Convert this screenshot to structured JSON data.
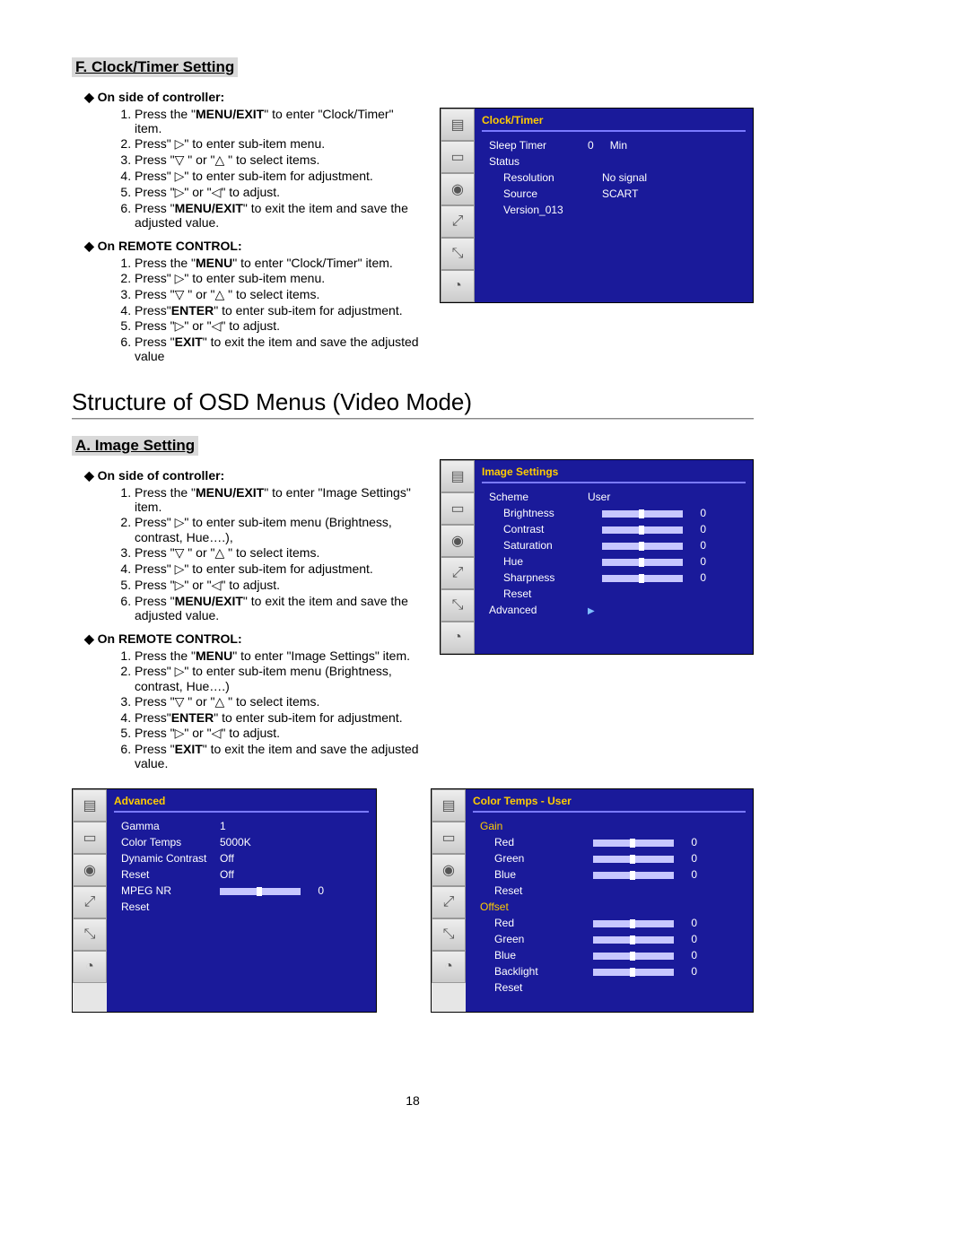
{
  "sectionF": {
    "title": "F. Clock/Timer Setting",
    "side_head": "On side of controller:",
    "side_steps": [
      "Press the \"<b class='k'>MENU/EXIT</b>\" to enter \"Clock/Timer\" item.",
      "Press\" ▷\" to enter sub-item menu.",
      "Press \"▽ \" or \"△ \" to select items.",
      "Press\" ▷\" to enter sub-item for adjustment.",
      "Press \"▷\" or \"◁\" to adjust.",
      "Press \"<b class='k'>MENU/EXIT</b>\" to exit the item and save the adjusted value."
    ],
    "remote_head": "On REMOTE CONTROL:",
    "remote_steps": [
      "Press the \"<b class='k'>MENU</b>\" to enter \"Clock/Timer\" item.",
      "Press\" ▷\" to enter sub-item menu.",
      "Press \"▽ \" or \"△ \" to select items.",
      "Press\"<b class='k'>ENTER</b>\" to enter sub-item for adjustment.",
      "Press \"▷\" or \"◁\" to adjust.",
      "Press \"<b class='k'>EXIT</b>\" to exit the item and save the adjusted value"
    ]
  },
  "osd_clock": {
    "title": "Clock/Timer",
    "rows": [
      {
        "label": "Sleep Timer",
        "val": "0",
        "unit": "Min"
      },
      {
        "label": "Status",
        "val": ""
      },
      {
        "label": "Resolution",
        "val": "No signal",
        "sub": true
      },
      {
        "label": "Source",
        "val": "SCART",
        "sub": true
      },
      {
        "label": "Version_013",
        "val": "",
        "sub": true
      }
    ]
  },
  "main_title": "Structure of OSD Menus (Video Mode)",
  "sectionA": {
    "title": "A. Image Setting",
    "side_head": "On side of controller:",
    "side_steps": [
      "Press the \"<b class='k'>MENU/EXIT</b>\" to enter \"Image Settings\" item.",
      "Press\" ▷\" to enter sub-item menu (Brightness, contrast, Hue….),",
      "Press \"▽ \" or \"△ \" to select items.",
      "Press\" ▷\" to enter sub-item for adjustment.",
      "Press \"▷\" or \"◁\" to adjust.",
      "Press \"<b class='k'>MENU/EXIT</b>\" to exit the item and save the adjusted value."
    ],
    "remote_head": "On REMOTE CONTROL:",
    "remote_steps": [
      "Press the \"<b class='k'>MENU</b>\" to enter \"Image Settings\" item.",
      "Press\" ▷\" to enter sub-item menu (Brightness, contrast, Hue….)",
      "Press \"▽ \" or \"△ \" to select items.",
      "Press\"<b class='k'>ENTER</b>\" to enter sub-item for adjustment.",
      "Press \"▷\" or \"◁\" to adjust.",
      "Press \"<b class='k'>EXIT</b>\" to exit the item and save the adjusted value."
    ]
  },
  "osd_image": {
    "title": "Image Settings",
    "rows": [
      {
        "label": "Scheme",
        "val": "User"
      },
      {
        "label": "Brightness",
        "slider": true,
        "num": "0",
        "sub": true
      },
      {
        "label": "Contrast",
        "slider": true,
        "num": "0",
        "sub": true
      },
      {
        "label": "Saturation",
        "slider": true,
        "num": "0",
        "sub": true
      },
      {
        "label": "Hue",
        "slider": true,
        "num": "0",
        "sub": true
      },
      {
        "label": "Sharpness",
        "slider": true,
        "num": "0",
        "sub": true
      },
      {
        "label": "Reset",
        "val": "",
        "sub": true
      },
      {
        "label": "Advanced",
        "arrow": true
      }
    ]
  },
  "osd_advanced": {
    "title": "Advanced",
    "rows": [
      {
        "label": "Gamma",
        "val": "1"
      },
      {
        "label": "Color Temps",
        "val": "5000K"
      },
      {
        "label": "Dynamic Contrast",
        "val": "Off"
      },
      {
        "label": "Reset",
        "val": "Off"
      },
      {
        "label": "MPEG NR",
        "slider": true,
        "num": "0"
      },
      {
        "label": "Reset",
        "val": ""
      }
    ]
  },
  "osd_colortemp": {
    "title": "Color Temps - User",
    "sections": [
      {
        "header": "Gain",
        "rows": [
          {
            "label": "Red",
            "slider": true,
            "num": "0"
          },
          {
            "label": "Green",
            "slider": true,
            "num": "0"
          },
          {
            "label": "Blue",
            "slider": true,
            "num": "0"
          },
          {
            "label": "Reset"
          }
        ]
      },
      {
        "header": "Offset",
        "rows": [
          {
            "label": "Red",
            "slider": true,
            "num": "0"
          },
          {
            "label": "Green",
            "slider": true,
            "num": "0"
          },
          {
            "label": "Blue",
            "slider": true,
            "num": "0"
          },
          {
            "label": "Backlight",
            "slider": true,
            "num": "0"
          },
          {
            "label": "Reset"
          }
        ]
      }
    ]
  },
  "tab_icons": [
    "▤",
    "▭",
    "◉",
    "⤢",
    "⤡",
    "◔"
  ],
  "page_number": "18"
}
